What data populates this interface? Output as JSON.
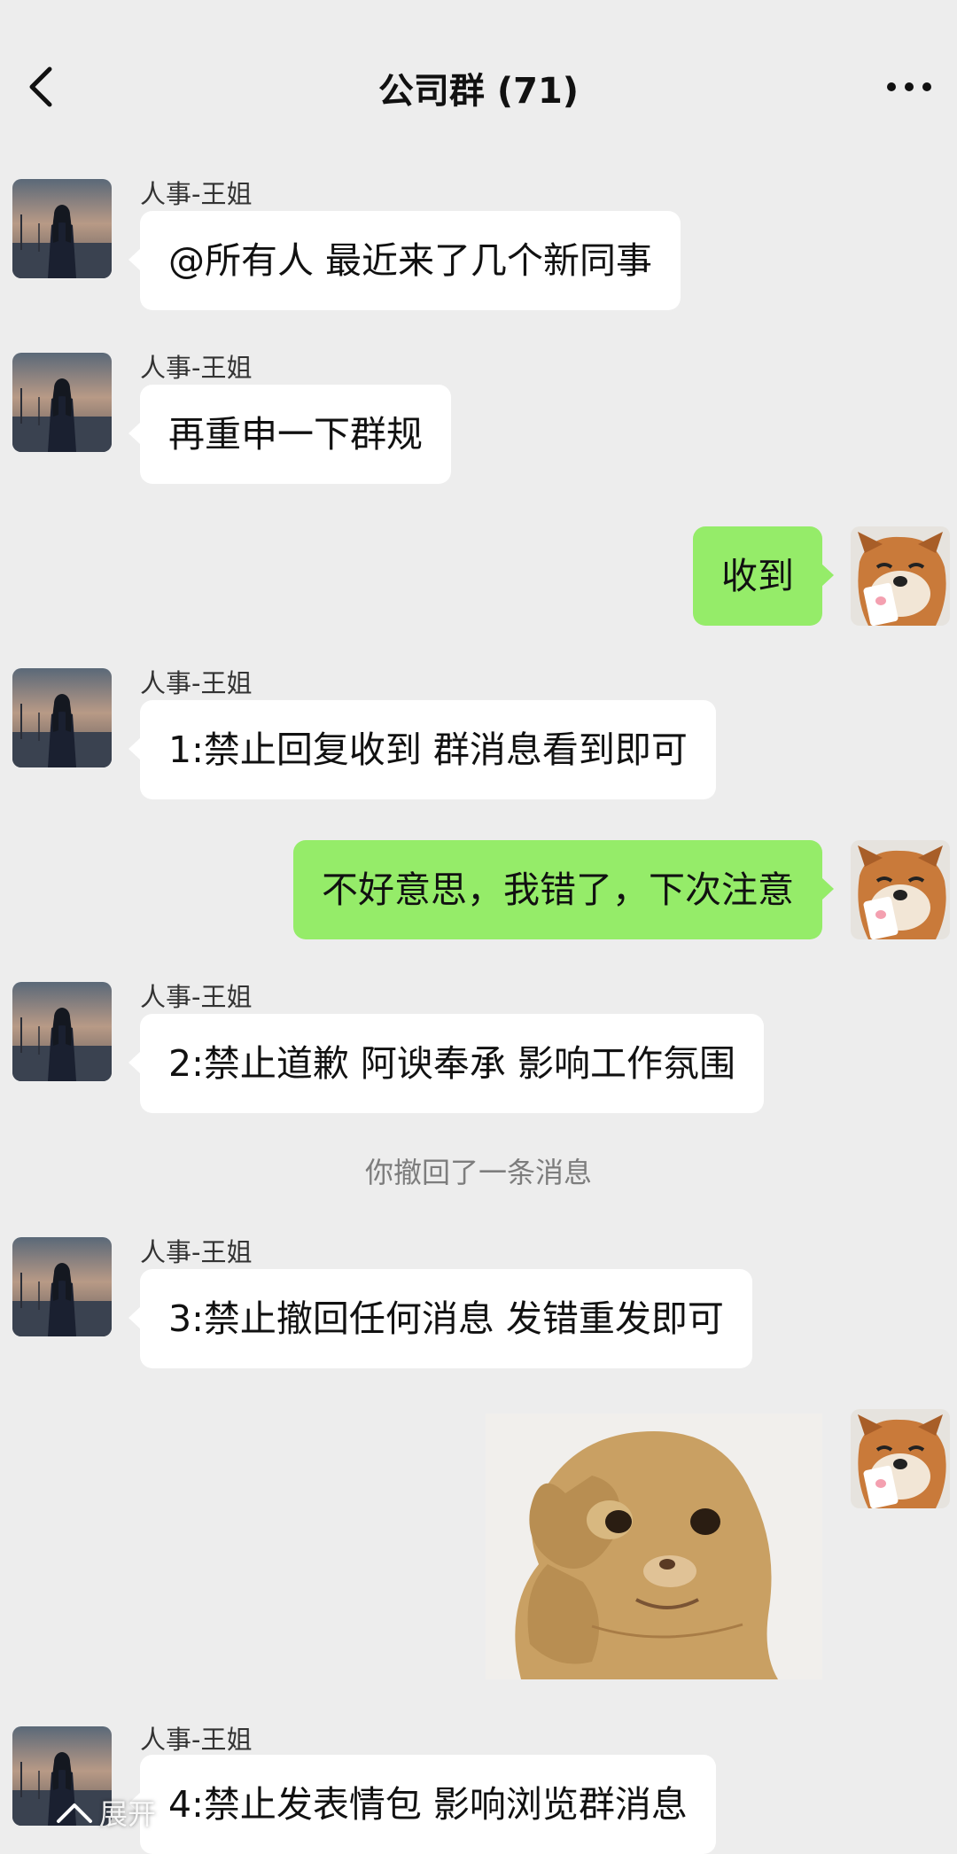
{
  "header": {
    "title": "公司群 (71)"
  },
  "messages": [
    {
      "sender": "人事-王姐",
      "text": "@所有人 最近来了几个新同事"
    },
    {
      "sender": "人事-王姐",
      "text": "再重申一下群规"
    },
    {
      "text": "收到"
    },
    {
      "sender": "人事-王姐",
      "text": "1:禁止回复收到  群消息看到即可"
    },
    {
      "text": "不好意思，我错了，下次注意"
    },
    {
      "sender": "人事-王姐",
      "text": "2:禁止道歉 阿谀奉承 影响工作氛围"
    },
    {
      "system": "你撤回了一条消息"
    },
    {
      "sender": "人事-王姐",
      "text": "3:禁止撤回任何消息 发错重发即可"
    },
    {
      "sticker": "cat-covering-face-sticker"
    },
    {
      "sender": "人事-王姐",
      "text": "4:禁止发表情包 影响浏览群消息"
    }
  ],
  "footer": {
    "expand_label": "展开"
  },
  "colors": {
    "background": "#ededed",
    "incoming_bubble": "#ffffff",
    "outgoing_bubble": "#95ec69"
  },
  "icons": {
    "back": "chevron-left-icon",
    "more": "more-dots-icon",
    "expand": "chevron-up-icon"
  }
}
